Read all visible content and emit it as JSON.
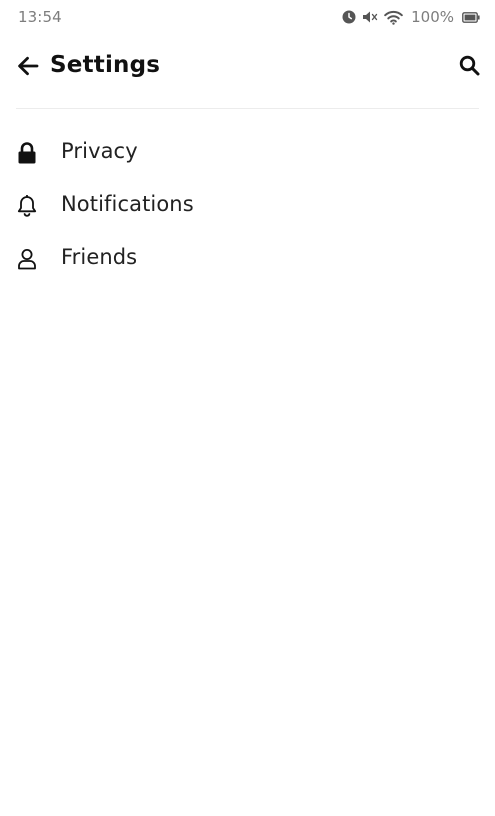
{
  "status_bar": {
    "time": "13:54",
    "battery": "100%",
    "icons": [
      "alarm-icon",
      "mute-icon",
      "wifi-icon",
      "battery-icon"
    ]
  },
  "header": {
    "title": "Settings",
    "back_icon": "arrow-left-icon",
    "search_icon": "search-icon"
  },
  "settings": {
    "items": [
      {
        "label": "Privacy",
        "icon": "lock-icon"
      },
      {
        "label": "Notifications",
        "icon": "bell-icon"
      },
      {
        "label": "Friends",
        "icon": "person-icon"
      }
    ]
  },
  "colors": {
    "background": "#ffffff",
    "text": "#111111",
    "status_text": "#7d7d7d",
    "divider": "#ececec"
  }
}
